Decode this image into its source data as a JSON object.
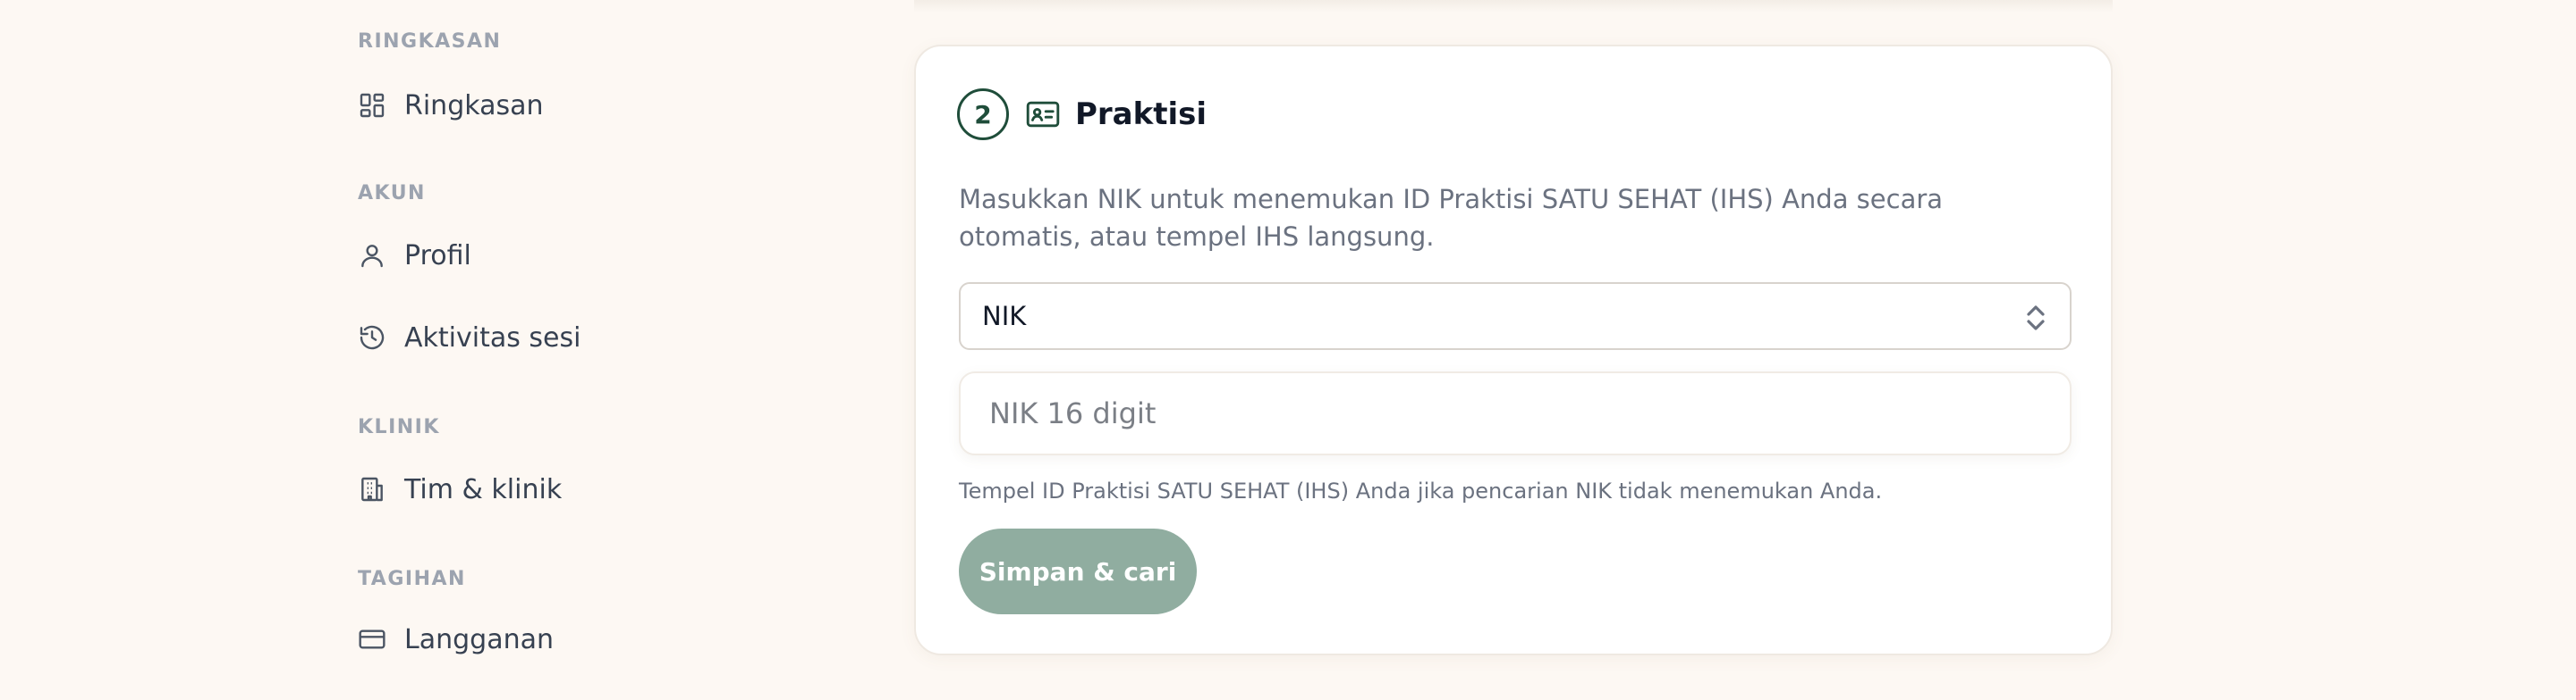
{
  "sidebar": {
    "sections": [
      {
        "label": "RINGKASAN",
        "items": [
          {
            "label": "Ringkasan",
            "icon": "dashboard-icon"
          }
        ]
      },
      {
        "label": "AKUN",
        "items": [
          {
            "label": "Profil",
            "icon": "user-icon"
          },
          {
            "label": "Aktivitas sesi",
            "icon": "history-icon"
          }
        ]
      },
      {
        "label": "KLINIK",
        "items": [
          {
            "label": "Tim & klinik",
            "icon": "building-icon"
          }
        ]
      },
      {
        "label": "TAGIHAN",
        "items": [
          {
            "label": "Langganan",
            "icon": "credit-card-icon"
          }
        ]
      }
    ]
  },
  "card": {
    "step": "2",
    "icon": "id-card-icon",
    "title": "Praktisi",
    "description": "Masukkan NIK untuk menemukan ID Praktisi SATU SEHAT (IHS) Anda secara otomatis, atau tempel IHS langsung.",
    "select_value": "NIK",
    "input_placeholder": "NIK 16 digit",
    "input_value": "",
    "hint": "Tempel ID Praktisi SATU SEHAT (IHS) Anda jika pencarian NIK tidak menemukan Anda.",
    "button_label": "Simpan & cari"
  },
  "colors": {
    "background": "#fdf8f3",
    "accent": "#1f4d3a",
    "button": "#90ada0"
  }
}
